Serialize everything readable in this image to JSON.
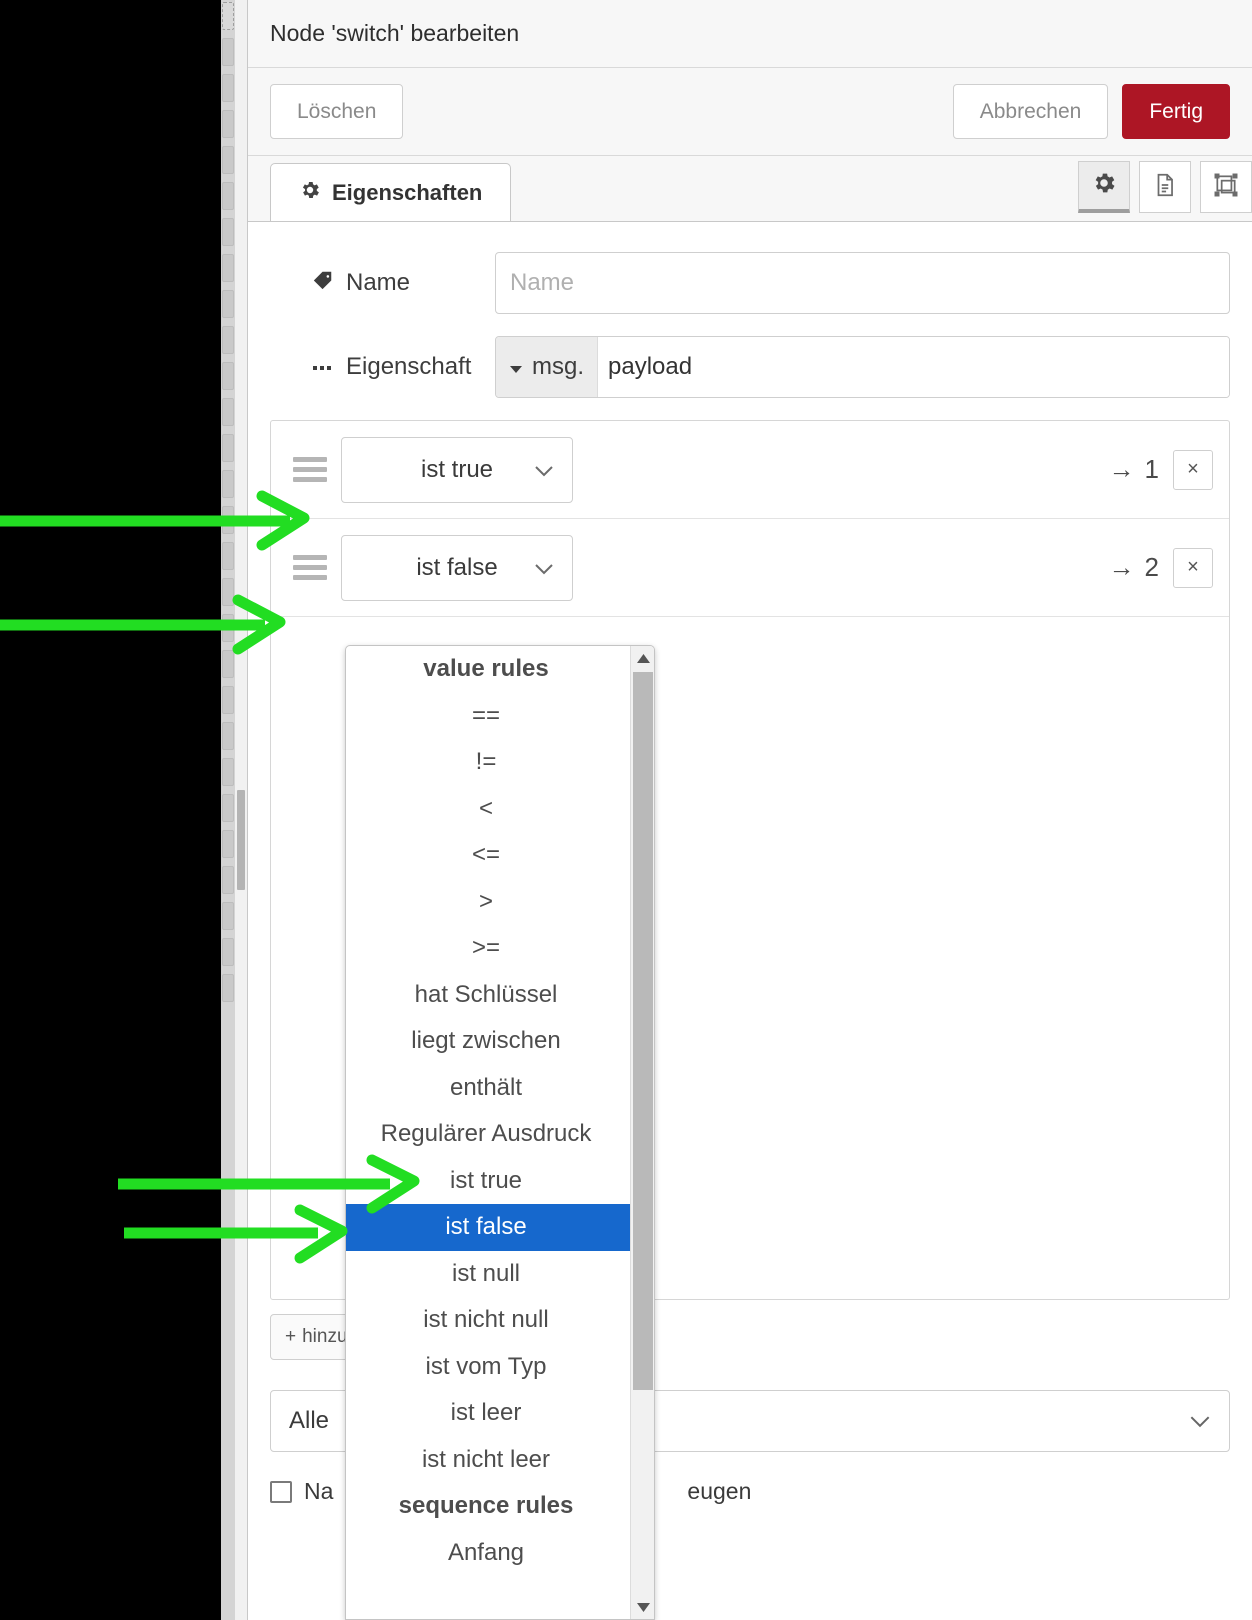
{
  "dialog": {
    "title": "Node 'switch' bearbeiten",
    "buttons": {
      "delete": "Löschen",
      "cancel": "Abbrechen",
      "done": "Fertig"
    },
    "tabs": [
      {
        "label": "Eigenschaften",
        "icon": "gear-icon",
        "active": true
      }
    ],
    "tab_icons": [
      {
        "name": "gear-icon",
        "active": true
      },
      {
        "name": "document-icon",
        "active": false
      },
      {
        "name": "appearance-icon",
        "active": false
      }
    ]
  },
  "form": {
    "name": {
      "label": "Name",
      "icon": "tag-icon",
      "value": "",
      "placeholder": "Name"
    },
    "property": {
      "label": "Eigenschaft",
      "icon": "ellipsis-icon",
      "type_prefix": "msg.",
      "value": "payload",
      "dropdown_icon": "caret-down-icon"
    }
  },
  "rules": [
    {
      "operator": "ist true",
      "output": "1",
      "output_arrow": "→",
      "delete_icon": "×",
      "handle_icon": "drag-handle-icon"
    },
    {
      "operator": "ist false",
      "output": "2",
      "output_arrow": "→",
      "delete_icon": "×",
      "handle_icon": "drag-handle-icon"
    }
  ],
  "add_button": {
    "label": "hinzufügen",
    "icon": "plus-icon"
  },
  "bottom_select": {
    "value": "Alle",
    "chevron": "chevron-down-icon"
  },
  "checkbox": {
    "label_before": "Na",
    "label_after": "eugen",
    "checked": false
  },
  "dropdown": {
    "open": true,
    "selected": "ist false",
    "scroll_up_icon": "triangle-up-icon",
    "scroll_down_icon": "triangle-down-icon",
    "items": [
      {
        "label": "value rules",
        "group": true
      },
      {
        "label": "==",
        "group": false
      },
      {
        "label": "!=",
        "group": false
      },
      {
        "label": "<",
        "group": false
      },
      {
        "label": "<=",
        "group": false
      },
      {
        "label": ">",
        "group": false
      },
      {
        "label": ">=",
        "group": false
      },
      {
        "label": "hat Schlüssel",
        "group": false
      },
      {
        "label": "liegt zwischen",
        "group": false
      },
      {
        "label": "enthält",
        "group": false
      },
      {
        "label": "Regulärer Ausdruck",
        "group": false
      },
      {
        "label": "ist true",
        "group": false
      },
      {
        "label": "ist false",
        "group": false,
        "selected": true
      },
      {
        "label": "ist null",
        "group": false
      },
      {
        "label": "ist nicht null",
        "group": false
      },
      {
        "label": "ist vom Typ",
        "group": false
      },
      {
        "label": "ist leer",
        "group": false
      },
      {
        "label": "ist nicht leer",
        "group": false
      },
      {
        "label": "sequence rules",
        "group": true
      },
      {
        "label": "Anfang",
        "group": false
      }
    ]
  },
  "annotations": {
    "color": "#22dd22",
    "arrows": [
      {
        "target": "rule-1-handle"
      },
      {
        "target": "rule-2-handle"
      },
      {
        "target": "dropdown-item-ist-true"
      },
      {
        "target": "dropdown-item-ist-false"
      }
    ]
  }
}
